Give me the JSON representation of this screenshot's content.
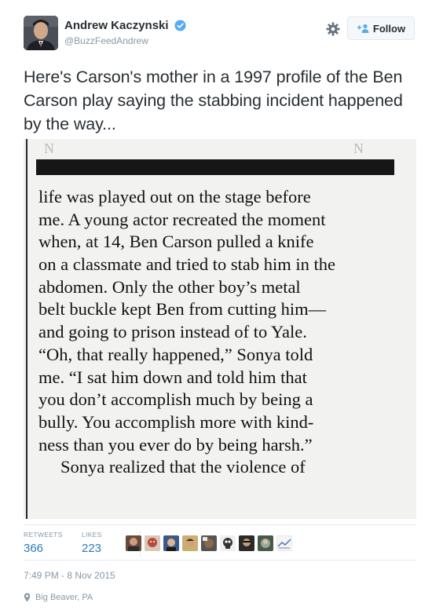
{
  "author": {
    "name": "Andrew Kaczynski",
    "handle": "@BuzzFeedAndrew",
    "verified": true
  },
  "actions": {
    "follow_label": "Follow"
  },
  "tweet": {
    "text": "Here's Carson's mother in a 1997 profile of the Ben Carson play saying the stabbing incident happened by the way..."
  },
  "clipping": {
    "lines": [
      "life was played out on the stage before",
      "me. A young actor recreated the moment",
      "when, at 14, Ben Carson pulled a knife",
      "on a classmate and tried to stab him in the",
      "abdomen. Only the other boy’s metal",
      "belt buckle kept Ben from cutting him—",
      "and going to prison instead of to Yale.",
      "“Oh, that really happened,” Sonya told",
      "me. “I sat him down and told him that",
      "you don’t accomplish much by being a",
      "bully. You accomplish more with kind-",
      "ness than you ever do by being harsh.”",
      "Sonya realized that the violence of"
    ]
  },
  "stats": {
    "retweets_label": "RETWEETS",
    "retweets_value": "366",
    "likes_label": "LIKES",
    "likes_value": "223"
  },
  "liker_avatars": [
    "avatar-1",
    "avatar-2",
    "avatar-3",
    "avatar-4",
    "avatar-5",
    "avatar-6",
    "avatar-7",
    "avatar-8",
    "avatar-9"
  ],
  "meta": {
    "timestamp": "7:49 PM - 8 Nov 2015",
    "location": "Big Beaver, PA"
  },
  "colors": {
    "link_blue": "#2b7bb9",
    "verified_blue": "#55acee",
    "muted": "#8899a6",
    "text": "#292f33"
  }
}
